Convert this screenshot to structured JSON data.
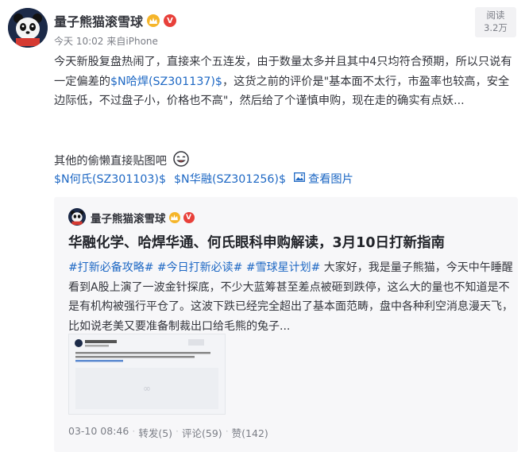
{
  "post": {
    "author": "量子熊猫滚雪球",
    "vip_badge": "V",
    "time": "今天 10:02",
    "source": "来自iPhone",
    "views_label": "阅读",
    "views_count": "3.2万",
    "body_p1_part1": "今天新股复盘热闹了，直接来个五连发，由于数量太多并且其中4只均符合预期，所以只说有一定偏差的",
    "stock_link1": "$N哈焊(SZ301137)$",
    "body_p1_part2": "，这货之前的评价是\"基本面不太行，市盈率也较高，安全边际低，不过盘子小，价格也不高\"，然后给了个谨慎申购，现在走的确实有点妖...",
    "line2_text": "其他的偷懒直接贴图吧",
    "stock_link2": "$N何氏(SZ301103)$",
    "stock_link3": "$N华融(SZ301256)$",
    "view_images": "查看图片"
  },
  "quoted": {
    "author": "量子熊猫滚雪球",
    "vip_badge": "V",
    "title": "华融化学、哈焊华通、何氏眼科申购解读，3月10日打新指南",
    "tags": [
      "#打新必备攻略#",
      "#今日打新必读#",
      "#雪球星计划#"
    ],
    "body_text": "大家好，我是量子熊猫，今天中午睡醒看到A股上演了一波金针探底，不少大蓝筹甚至差点被砸到跌停，这么大的量也不知道是不是有机构被强行平仓了。这波下跌已经完全超出了基本面范畴，盘中各种利空消息漫天飞，比如说老美又要准备制裁出口给毛熊的兔子...",
    "date": "03-10 08:46",
    "reposts": "转发(5)",
    "comments": "评论(59)",
    "likes": "赞(142)",
    "sep": "·"
  },
  "colors": {
    "link": "#1e68c4",
    "text": "#33353c",
    "muted": "#7b7e86",
    "card_bg": "#f7f7f9",
    "badge_gold": "#f5b52a",
    "badge_red": "#e8403a"
  }
}
